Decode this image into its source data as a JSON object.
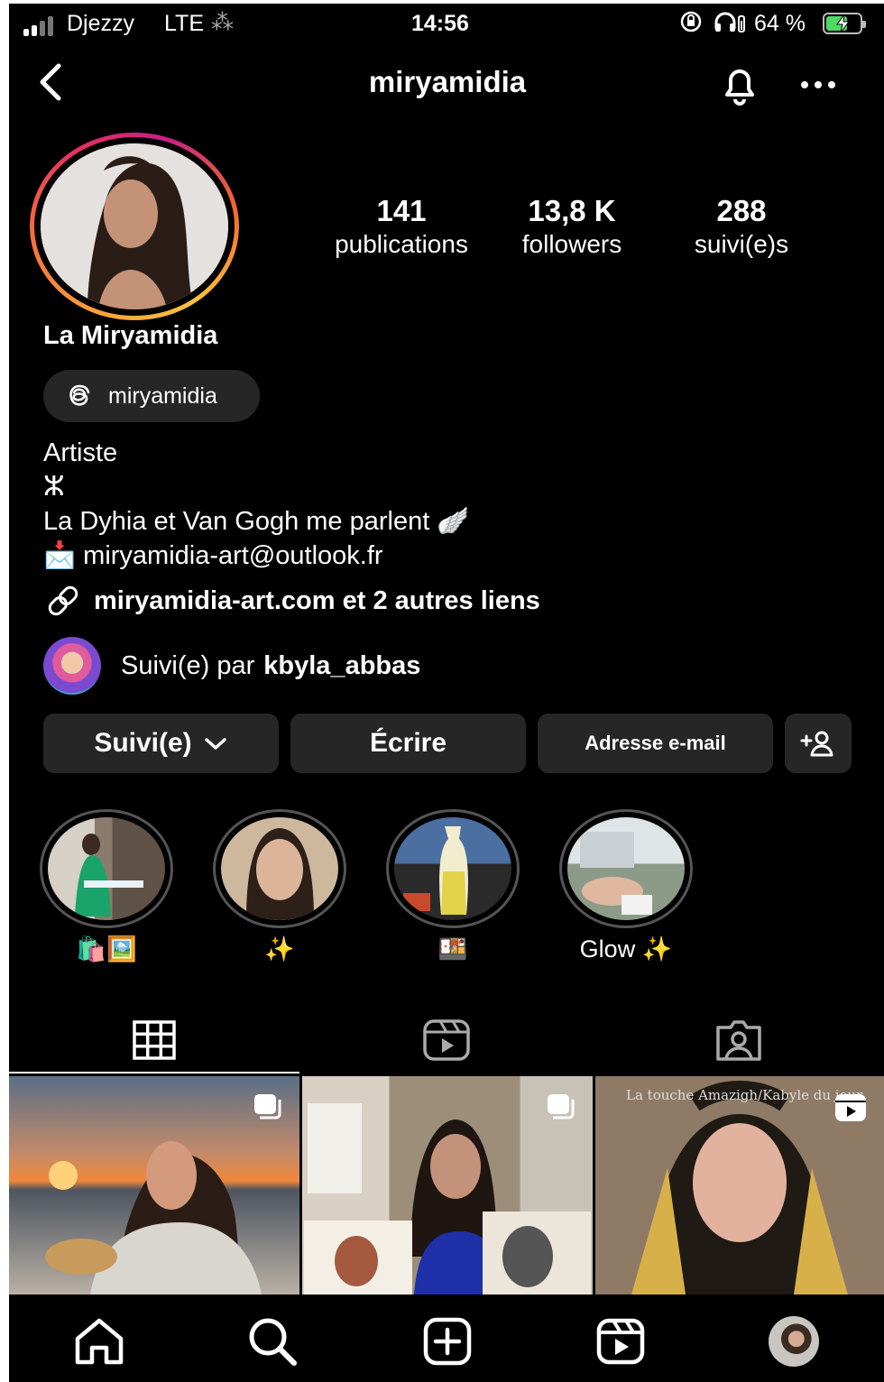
{
  "status_bar": {
    "carrier": "Djezzy",
    "network": "LTE",
    "time": "14:56",
    "battery_percent": "64 %",
    "battery_level": 0.64,
    "battery_color": "#4cd964"
  },
  "header": {
    "username": "miryamidia",
    "icons": [
      "back-chevron-icon",
      "notification-bell-icon",
      "more-options-icon"
    ]
  },
  "profile": {
    "display_name": "La Miryamidia",
    "threads_handle": "miryamidia",
    "stats": [
      {
        "value": "141",
        "label": "publications"
      },
      {
        "value": "13,8 K",
        "label": "followers"
      },
      {
        "value": "288",
        "label": "suivi(e)s"
      }
    ],
    "bio": {
      "line1": "Artiste",
      "line2": "ⵣ",
      "line3_text": "La Dyhia et Van Gogh me parlent",
      "line3_emoji": "🪽",
      "email_emoji": "📩",
      "email": "miryamidia-art@outlook.fr",
      "link_text": "miryamidia-art.com et 2 autres liens"
    },
    "followed_by_prefix": "Suivi(e) par",
    "followed_by_user": "kbyla_abbas"
  },
  "actions": {
    "following_label": "Suivi(e)",
    "message_label": "Écrire",
    "email_label": "Adresse e-mail",
    "suggest_icon": "add-person-icon"
  },
  "highlights": [
    {
      "label": "🛍️🖼️"
    },
    {
      "label": "✨"
    },
    {
      "label": "🍱"
    },
    {
      "label": "Glow ✨"
    }
  ],
  "tabs": [
    "grid-icon",
    "reels-icon",
    "tagged-icon"
  ],
  "posts": [
    {
      "type": "carousel",
      "caption": ""
    },
    {
      "type": "carousel",
      "caption": ""
    },
    {
      "type": "reel",
      "caption": "La touche Amazigh/Kabyle du jour"
    }
  ],
  "bottom_nav": [
    "home-icon",
    "search-icon",
    "create-icon",
    "reels-icon",
    "profile-avatar"
  ],
  "accent_colors": {
    "background": "#000000",
    "button_bg": "#262626",
    "story_ring_start": "#f9a23c",
    "story_ring_end": "#c51f8a"
  }
}
